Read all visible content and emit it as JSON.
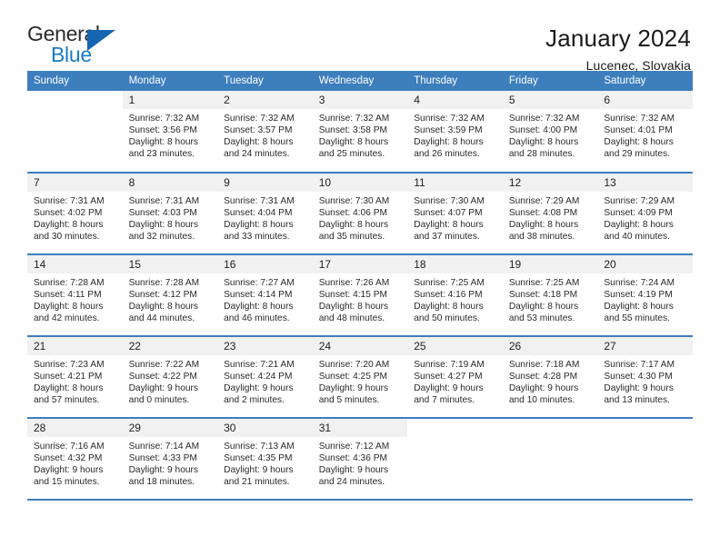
{
  "brand": {
    "name_part1": "General",
    "name_part2": "Blue",
    "flag_icon": "blue-triangle-flag"
  },
  "header": {
    "title": "January 2024",
    "subtitle": "Lucenec, Slovakia"
  },
  "colors": {
    "header_blue": "#3d7ebd",
    "brand_blue": "#1a7bc4",
    "daynum_bg": "#f1f1f1",
    "text": "#2a2a2a"
  },
  "weekdays": [
    "Sunday",
    "Monday",
    "Tuesday",
    "Wednesday",
    "Thursday",
    "Friday",
    "Saturday"
  ],
  "labels": {
    "sunrise": "Sunrise:",
    "sunset": "Sunset:",
    "daylight": "Daylight:"
  },
  "weeks": [
    [
      {
        "day": "",
        "blank": true
      },
      {
        "day": "1",
        "sunrise": "Sunrise: 7:32 AM",
        "sunset": "Sunset: 3:56 PM",
        "daylight1": "Daylight: 8 hours",
        "daylight2": "and 23 minutes."
      },
      {
        "day": "2",
        "sunrise": "Sunrise: 7:32 AM",
        "sunset": "Sunset: 3:57 PM",
        "daylight1": "Daylight: 8 hours",
        "daylight2": "and 24 minutes."
      },
      {
        "day": "3",
        "sunrise": "Sunrise: 7:32 AM",
        "sunset": "Sunset: 3:58 PM",
        "daylight1": "Daylight: 8 hours",
        "daylight2": "and 25 minutes."
      },
      {
        "day": "4",
        "sunrise": "Sunrise: 7:32 AM",
        "sunset": "Sunset: 3:59 PM",
        "daylight1": "Daylight: 8 hours",
        "daylight2": "and 26 minutes."
      },
      {
        "day": "5",
        "sunrise": "Sunrise: 7:32 AM",
        "sunset": "Sunset: 4:00 PM",
        "daylight1": "Daylight: 8 hours",
        "daylight2": "and 28 minutes."
      },
      {
        "day": "6",
        "sunrise": "Sunrise: 7:32 AM",
        "sunset": "Sunset: 4:01 PM",
        "daylight1": "Daylight: 8 hours",
        "daylight2": "and 29 minutes."
      }
    ],
    [
      {
        "day": "7",
        "sunrise": "Sunrise: 7:31 AM",
        "sunset": "Sunset: 4:02 PM",
        "daylight1": "Daylight: 8 hours",
        "daylight2": "and 30 minutes."
      },
      {
        "day": "8",
        "sunrise": "Sunrise: 7:31 AM",
        "sunset": "Sunset: 4:03 PM",
        "daylight1": "Daylight: 8 hours",
        "daylight2": "and 32 minutes."
      },
      {
        "day": "9",
        "sunrise": "Sunrise: 7:31 AM",
        "sunset": "Sunset: 4:04 PM",
        "daylight1": "Daylight: 8 hours",
        "daylight2": "and 33 minutes."
      },
      {
        "day": "10",
        "sunrise": "Sunrise: 7:30 AM",
        "sunset": "Sunset: 4:06 PM",
        "daylight1": "Daylight: 8 hours",
        "daylight2": "and 35 minutes."
      },
      {
        "day": "11",
        "sunrise": "Sunrise: 7:30 AM",
        "sunset": "Sunset: 4:07 PM",
        "daylight1": "Daylight: 8 hours",
        "daylight2": "and 37 minutes."
      },
      {
        "day": "12",
        "sunrise": "Sunrise: 7:29 AM",
        "sunset": "Sunset: 4:08 PM",
        "daylight1": "Daylight: 8 hours",
        "daylight2": "and 38 minutes."
      },
      {
        "day": "13",
        "sunrise": "Sunrise: 7:29 AM",
        "sunset": "Sunset: 4:09 PM",
        "daylight1": "Daylight: 8 hours",
        "daylight2": "and 40 minutes."
      }
    ],
    [
      {
        "day": "14",
        "sunrise": "Sunrise: 7:28 AM",
        "sunset": "Sunset: 4:11 PM",
        "daylight1": "Daylight: 8 hours",
        "daylight2": "and 42 minutes."
      },
      {
        "day": "15",
        "sunrise": "Sunrise: 7:28 AM",
        "sunset": "Sunset: 4:12 PM",
        "daylight1": "Daylight: 8 hours",
        "daylight2": "and 44 minutes."
      },
      {
        "day": "16",
        "sunrise": "Sunrise: 7:27 AM",
        "sunset": "Sunset: 4:14 PM",
        "daylight1": "Daylight: 8 hours",
        "daylight2": "and 46 minutes."
      },
      {
        "day": "17",
        "sunrise": "Sunrise: 7:26 AM",
        "sunset": "Sunset: 4:15 PM",
        "daylight1": "Daylight: 8 hours",
        "daylight2": "and 48 minutes."
      },
      {
        "day": "18",
        "sunrise": "Sunrise: 7:25 AM",
        "sunset": "Sunset: 4:16 PM",
        "daylight1": "Daylight: 8 hours",
        "daylight2": "and 50 minutes."
      },
      {
        "day": "19",
        "sunrise": "Sunrise: 7:25 AM",
        "sunset": "Sunset: 4:18 PM",
        "daylight1": "Daylight: 8 hours",
        "daylight2": "and 53 minutes."
      },
      {
        "day": "20",
        "sunrise": "Sunrise: 7:24 AM",
        "sunset": "Sunset: 4:19 PM",
        "daylight1": "Daylight: 8 hours",
        "daylight2": "and 55 minutes."
      }
    ],
    [
      {
        "day": "21",
        "sunrise": "Sunrise: 7:23 AM",
        "sunset": "Sunset: 4:21 PM",
        "daylight1": "Daylight: 8 hours",
        "daylight2": "and 57 minutes."
      },
      {
        "day": "22",
        "sunrise": "Sunrise: 7:22 AM",
        "sunset": "Sunset: 4:22 PM",
        "daylight1": "Daylight: 9 hours",
        "daylight2": "and 0 minutes."
      },
      {
        "day": "23",
        "sunrise": "Sunrise: 7:21 AM",
        "sunset": "Sunset: 4:24 PM",
        "daylight1": "Daylight: 9 hours",
        "daylight2": "and 2 minutes."
      },
      {
        "day": "24",
        "sunrise": "Sunrise: 7:20 AM",
        "sunset": "Sunset: 4:25 PM",
        "daylight1": "Daylight: 9 hours",
        "daylight2": "and 5 minutes."
      },
      {
        "day": "25",
        "sunrise": "Sunrise: 7:19 AM",
        "sunset": "Sunset: 4:27 PM",
        "daylight1": "Daylight: 9 hours",
        "daylight2": "and 7 minutes."
      },
      {
        "day": "26",
        "sunrise": "Sunrise: 7:18 AM",
        "sunset": "Sunset: 4:28 PM",
        "daylight1": "Daylight: 9 hours",
        "daylight2": "and 10 minutes."
      },
      {
        "day": "27",
        "sunrise": "Sunrise: 7:17 AM",
        "sunset": "Sunset: 4:30 PM",
        "daylight1": "Daylight: 9 hours",
        "daylight2": "and 13 minutes."
      }
    ],
    [
      {
        "day": "28",
        "sunrise": "Sunrise: 7:16 AM",
        "sunset": "Sunset: 4:32 PM",
        "daylight1": "Daylight: 9 hours",
        "daylight2": "and 15 minutes."
      },
      {
        "day": "29",
        "sunrise": "Sunrise: 7:14 AM",
        "sunset": "Sunset: 4:33 PM",
        "daylight1": "Daylight: 9 hours",
        "daylight2": "and 18 minutes."
      },
      {
        "day": "30",
        "sunrise": "Sunrise: 7:13 AM",
        "sunset": "Sunset: 4:35 PM",
        "daylight1": "Daylight: 9 hours",
        "daylight2": "and 21 minutes."
      },
      {
        "day": "31",
        "sunrise": "Sunrise: 7:12 AM",
        "sunset": "Sunset: 4:36 PM",
        "daylight1": "Daylight: 9 hours",
        "daylight2": "and 24 minutes."
      },
      {
        "day": "",
        "blank": true
      },
      {
        "day": "",
        "blank": true
      },
      {
        "day": "",
        "blank": true
      }
    ]
  ]
}
